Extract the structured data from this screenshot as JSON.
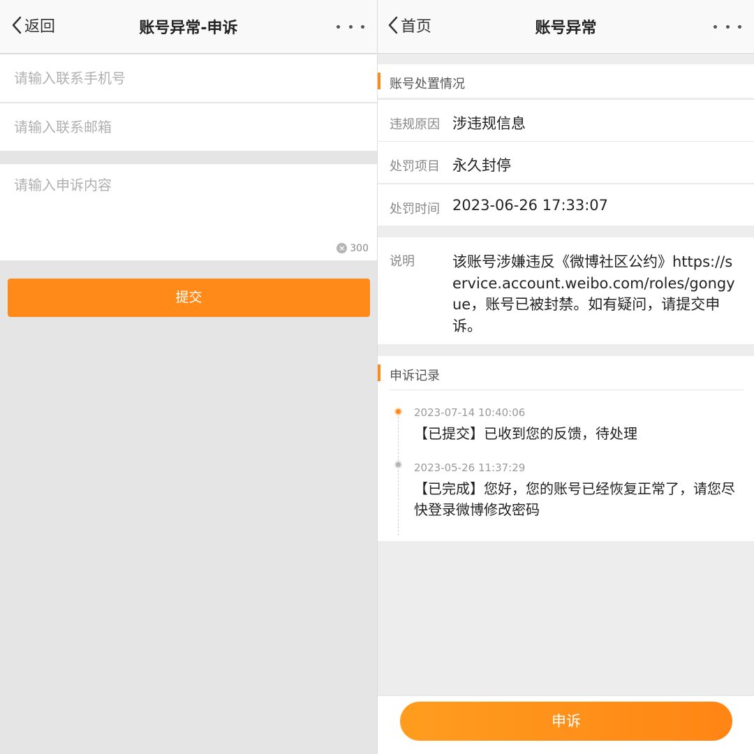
{
  "left": {
    "nav": {
      "back_label": "返回",
      "title": "账号异常-申诉"
    },
    "form": {
      "phone_placeholder": "请输入联系手机号",
      "email_placeholder": "请输入联系邮箱",
      "content_placeholder": "请输入申诉内容",
      "char_limit": "300",
      "submit_label": "提交"
    }
  },
  "right": {
    "nav": {
      "back_label": "首页",
      "title": "账号异常"
    },
    "status": {
      "section_title": "账号处置情况",
      "rows": [
        {
          "key": "违规原因",
          "value": "涉违规信息"
        },
        {
          "key": "处罚项目",
          "value": "永久封停"
        },
        {
          "key": "处罚时间",
          "value": "2023-06-26 17:33:07"
        }
      ]
    },
    "note": {
      "key": "说明",
      "value": "该账号涉嫌违反《微博社区公约》https://service.account.weibo.com/roles/gongyue，账号已被封禁。如有疑问，请提交申诉。"
    },
    "records": {
      "section_title": "申诉记录",
      "items": [
        {
          "time": "2023-07-14 10:40:06",
          "text": "【已提交】已收到您的反馈，待处理",
          "state": "active"
        },
        {
          "time": "2023-05-26 11:37:29",
          "text": "【已完成】您好，您的账号已经恢复正常了，请您尽快登录微博修改密码",
          "state": "done"
        }
      ]
    },
    "appeal_label": "申诉"
  },
  "colors": {
    "accent": "#ff8a1a",
    "text": "#222222",
    "muted": "#888888"
  },
  "icons": [
    "chevron-left-icon",
    "more-icon",
    "clear-icon"
  ]
}
